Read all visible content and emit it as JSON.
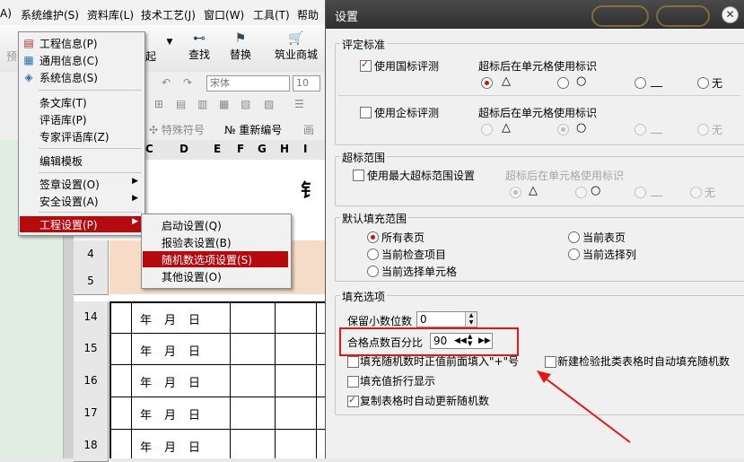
{
  "menubar": {
    "items": [
      "A)",
      "系统维护(S)",
      "资料库(L)",
      "技术工艺(J)",
      "窗口(W)",
      "工具(T)",
      "帮助"
    ]
  },
  "toolbar": {
    "left_stub": "预",
    "left_stub2": "起",
    "search_label": "查找",
    "replace_label": "替换",
    "mall_label": "筑业商城",
    "font_name": "宋体",
    "font_size": "10",
    "special_symbol": "特殊符号",
    "renumber": "重新编号",
    "more_stub": "画"
  },
  "sheet": {
    "col_headers": [
      "C",
      "D",
      "E",
      "F",
      "G",
      "H",
      "I"
    ],
    "rows_top": [
      "4",
      "5"
    ],
    "rows": [
      "14",
      "15",
      "16",
      "17",
      "18"
    ],
    "date_cells": [
      "年",
      "月",
      "日"
    ],
    "title_stub": "钅"
  },
  "main_menu": {
    "items": [
      {
        "icon": "document-icon",
        "label": "工程信息(P)"
      },
      {
        "icon": "info-icon",
        "label": "通用信息(C)"
      },
      {
        "icon": "system-icon",
        "label": "系统信息(S)"
      },
      {
        "label": "条文库(T)"
      },
      {
        "label": "评语库(P)"
      },
      {
        "label": "专家评语库(Z)"
      },
      {
        "label": "编辑模板"
      },
      {
        "label": "签章设置(O)",
        "submenu": true
      },
      {
        "label": "安全设置(A)",
        "submenu": true
      },
      {
        "label": "工程设置(P)",
        "submenu": true
      }
    ]
  },
  "sub_menu": {
    "items": [
      "启动设置(Q)",
      "报验表设置(B)",
      "随机数选项设置(S)",
      "其他设置(O)"
    ]
  },
  "dialog": {
    "title": "设置",
    "group_eval": {
      "label": "评定标准",
      "national": {
        "checkbox_label": "使用国标评测",
        "checked": true,
        "marker_label": "超标后在单元格使用标识"
      },
      "enterprise": {
        "checkbox_label": "使用企标评测",
        "checked": false,
        "marker_label": "超标后在单元格使用标识"
      },
      "options": [
        "△",
        "○",
        "__",
        "无"
      ],
      "national_selected": "△",
      "enterprise_selected": "○"
    },
    "group_range": {
      "label": "超标范围",
      "checkbox_label": "使用最大超标范围设置",
      "checked": false,
      "marker_label": "超标后在单元格使用标识",
      "options": [
        "△",
        "○",
        "__",
        "无"
      ],
      "selected": "△"
    },
    "group_default": {
      "label": "默认填充范围",
      "options": [
        "所有表页",
        "当前表页",
        "当前检查项目",
        "当前选择列",
        "当前选择单元格"
      ],
      "selected": "所有表页"
    },
    "group_fill": {
      "label": "填充选项",
      "decimal_label": "保留小数位数",
      "decimal_value": "0",
      "pass_pct_label": "合格点数百分比",
      "pass_pct_value": "90",
      "plus_label": "填充随机数时正值前面填入\"+\"号",
      "plus_checked": false,
      "new_batch_label": "新建检验批类表格时自动填充随机数",
      "new_batch_checked": false,
      "wrap_label": "填充值折行显示",
      "wrap_checked": false,
      "copy_label": "复制表格时自动更新随机数",
      "copy_checked": true
    },
    "close_glyph": "✕"
  },
  "annotation": {
    "color": "#e61616"
  }
}
